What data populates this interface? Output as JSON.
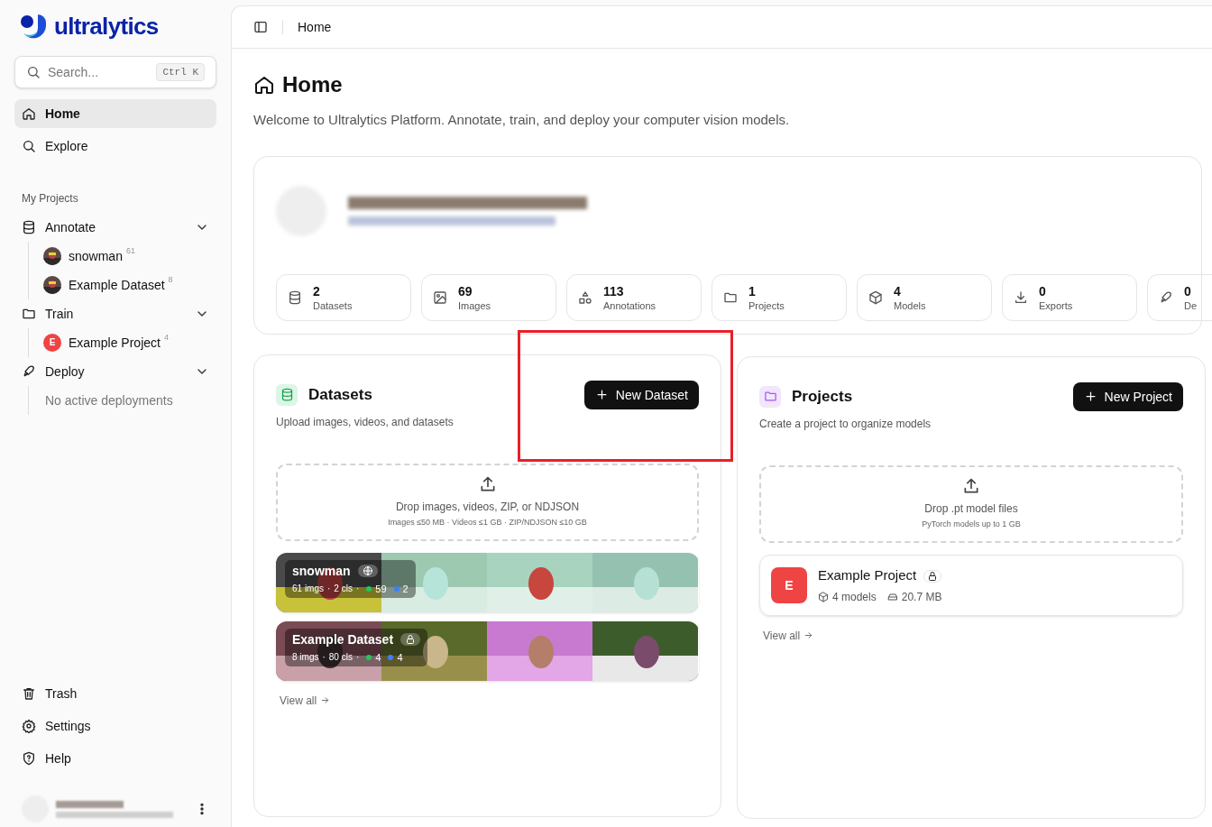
{
  "brand": {
    "name": "ultralytics"
  },
  "search": {
    "placeholder": "Search...",
    "shortcut": "Ctrl K"
  },
  "nav": [
    {
      "label": "Home",
      "selected": true
    },
    {
      "label": "Explore",
      "selected": false
    }
  ],
  "section_label": "My Projects",
  "groups": [
    {
      "label": "Annotate",
      "expanded": true,
      "children": [
        {
          "label": "snowman",
          "count": "61",
          "kind": "picture"
        },
        {
          "label": "Example Dataset",
          "count": "8",
          "kind": "picture"
        }
      ]
    },
    {
      "label": "Train",
      "expanded": true,
      "children": [
        {
          "label": "Example Project",
          "count": "4",
          "kind": "letter",
          "letter": "E"
        }
      ]
    },
    {
      "label": "Deploy",
      "expanded": true,
      "empty_text": "No active deployments"
    }
  ],
  "bottom_nav": [
    {
      "label": "Trash"
    },
    {
      "label": "Settings"
    },
    {
      "label": "Help"
    }
  ],
  "breadcrumb": "Home",
  "page": {
    "title": "Home",
    "subtitle": "Welcome to Ultralytics Platform. Annotate, train, and deploy your computer vision models."
  },
  "stats": [
    {
      "value": "2",
      "label": "Datasets"
    },
    {
      "value": "69",
      "label": "Images"
    },
    {
      "value": "113",
      "label": "Annotations"
    },
    {
      "value": "1",
      "label": "Projects"
    },
    {
      "value": "4",
      "label": "Models"
    },
    {
      "value": "0",
      "label": "Exports"
    },
    {
      "value": "0",
      "label": "De"
    }
  ],
  "datasets_panel": {
    "title": "Datasets",
    "subtitle": "Upload images, videos, and datasets",
    "button": "New Dataset",
    "drop_title": "Drop images, videos, ZIP, or NDJSON",
    "drop_hint": "Images ≤50 MB · Videos ≤1 GB · ZIP/NDJSON ≤10 GB",
    "items": [
      {
        "name": "snowman",
        "private": false,
        "images": "61 imgs",
        "classes": "2 cls",
        "sep": "·",
        "counts": [
          {
            "value": "59",
            "color": "#22c55e"
          },
          {
            "value": "2",
            "color": "#3b82f6"
          }
        ]
      },
      {
        "name": "Example Dataset",
        "private": true,
        "images": "8 imgs",
        "classes": "80 cls",
        "sep": "·",
        "counts": [
          {
            "value": "4",
            "color": "#22c55e"
          },
          {
            "value": "4",
            "color": "#3b82f6"
          }
        ]
      }
    ],
    "view_all": "View all"
  },
  "projects_panel": {
    "title": "Projects",
    "subtitle": "Create a project to organize models",
    "button": "New Project",
    "drop_title": "Drop .pt model files",
    "drop_hint": "PyTorch models up to 1 GB",
    "items": [
      {
        "letter": "E",
        "name": "Example Project",
        "private": true,
        "models": "4 models",
        "size": "20.7 MB"
      }
    ],
    "view_all": "View all"
  }
}
